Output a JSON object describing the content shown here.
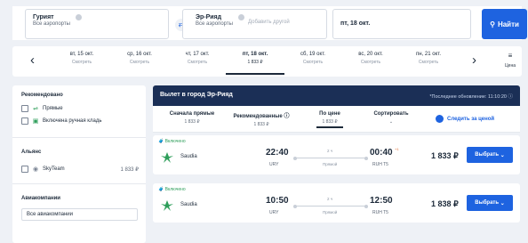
{
  "search": {
    "from_city": "Гурият",
    "from_sub": "Все аэропорты",
    "to_city": "Эр-Рияд",
    "to_sub": "Все аэропорты",
    "add_other": "Добавить другой",
    "date": "пт, 18 окт.",
    "find_label": "Найти"
  },
  "dates": [
    {
      "label": "вт, 15 окт.",
      "sub": "Смотреть"
    },
    {
      "label": "ср, 16 окт.",
      "sub": "Смотреть"
    },
    {
      "label": "чт, 17 окт.",
      "sub": "Смотреть"
    },
    {
      "label": "пт, 18 окт.",
      "sub": "1 833 ₽"
    },
    {
      "label": "сб, 19 окт.",
      "sub": "Смотреть"
    },
    {
      "label": "вс, 20 окт.",
      "sub": "Смотреть"
    },
    {
      "label": "пн, 21 окт.",
      "sub": "Смотреть"
    }
  ],
  "price_toggle": "Цена",
  "filters": {
    "recommended_title": "Рекомендовано",
    "direct_label": "Прямые",
    "baggage_label": "Включена ручная кладь",
    "alliance_title": "Альянс",
    "skyteam_label": "SkyTeam",
    "skyteam_price": "1 833 ₽",
    "airlines_title": "Авиакомпании",
    "airlines_select": "Все авиакомпании"
  },
  "results": {
    "title": "Вылет в город Эр-Рияд",
    "updated": "*Последнее обновление: 11:10:20",
    "sort": [
      {
        "label": "Сначала прямые",
        "value": "1 833 ₽"
      },
      {
        "label": "Рекомендованные",
        "value": "1 833 ₽"
      },
      {
        "label": "По цене",
        "value": "1 833 ₽"
      },
      {
        "label": "Сортировать",
        "value": ""
      }
    ],
    "track_label": "Следить за ценой",
    "flights": [
      {
        "badge": "Включено",
        "airline": "Saudia",
        "dep_time": "22:40",
        "dep_airport": "URY",
        "duration": "2 ч",
        "stops": "Прямой",
        "arr_time": "00:40",
        "plus_day": "+1",
        "arr_airport": "RUH T5",
        "price": "1 833 ₽",
        "button": "Выбрать"
      },
      {
        "badge": "Включено",
        "airline": "Saudia",
        "dep_time": "10:50",
        "dep_airport": "URY",
        "duration": "2 ч",
        "stops": "Прямой",
        "arr_time": "12:50",
        "plus_day": "",
        "arr_airport": "RUH T5",
        "price": "1 838 ₽",
        "button": "Выбрать"
      }
    ]
  }
}
